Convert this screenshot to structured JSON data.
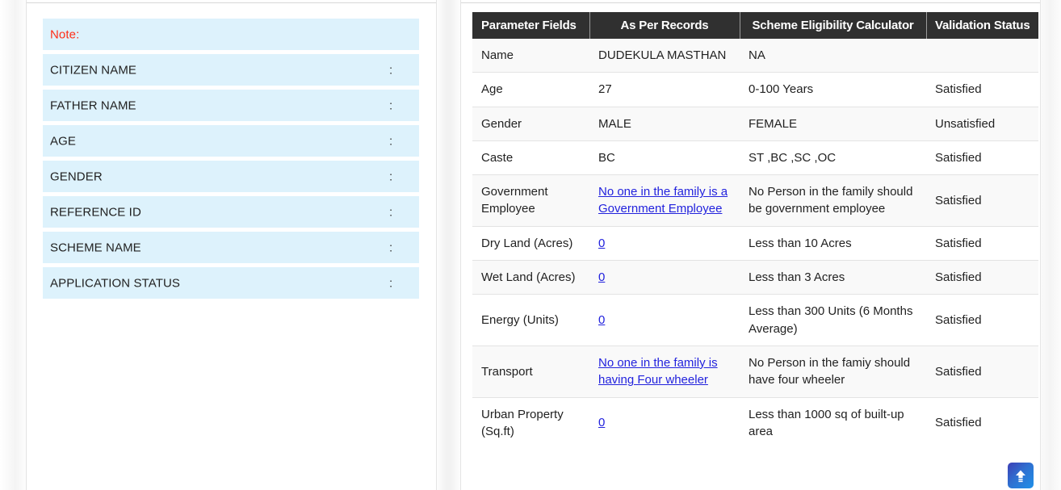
{
  "left_panel": {
    "rows": [
      {
        "label": "Note:",
        "colon": "",
        "is_note": true
      },
      {
        "label": "CITIZEN NAME",
        "colon": ":",
        "is_note": false
      },
      {
        "label": "FATHER NAME",
        "colon": ":",
        "is_note": false
      },
      {
        "label": "AGE",
        "colon": ":",
        "is_note": false
      },
      {
        "label": "GENDER",
        "colon": ":",
        "is_note": false
      },
      {
        "label": "REFERENCE ID",
        "colon": ":",
        "is_note": false
      },
      {
        "label": "SCHEME NAME",
        "colon": ":",
        "is_note": false
      },
      {
        "label": "APPLICATION STATUS",
        "colon": ":",
        "is_note": false
      }
    ]
  },
  "table": {
    "headers": [
      "Parameter Fields",
      "As Per Records",
      "Scheme Eligibility Calculator",
      "Validation Status"
    ],
    "rows": [
      {
        "parameter": "Name",
        "as_per_records": "DUDEKULA MASTHAN",
        "record_is_link": false,
        "calculator": "NA",
        "status": ""
      },
      {
        "parameter": "Age",
        "as_per_records": "27",
        "record_is_link": false,
        "calculator": "0-100 Years",
        "status": "Satisfied"
      },
      {
        "parameter": "Gender",
        "as_per_records": "MALE",
        "record_is_link": false,
        "calculator": "FEMALE",
        "status": "Unsatisfied"
      },
      {
        "parameter": "Caste",
        "as_per_records": "BC",
        "record_is_link": false,
        "calculator": "ST ,BC ,SC ,OC",
        "status": "Satisfied"
      },
      {
        "parameter": "Government Employee",
        "as_per_records": "No one in the  family is a Government  Employee",
        "record_is_link": true,
        "calculator": "No Person in the family should be government employee",
        "status": "Satisfied"
      },
      {
        "parameter": "Dry Land (Acres)",
        "as_per_records": "0",
        "record_is_link": true,
        "calculator": "Less than 10 Acres",
        "status": "Satisfied"
      },
      {
        "parameter": "Wet Land (Acres)",
        "as_per_records": "0",
        "record_is_link": true,
        "calculator": "Less than 3 Acres",
        "status": "Satisfied"
      },
      {
        "parameter": "Energy (Units)",
        "as_per_records": "0",
        "record_is_link": true,
        "calculator": "Less than 300 Units (6 Months Average)",
        "status": "Satisfied"
      },
      {
        "parameter": "Transport",
        "as_per_records": "No one in the family is having Four wheeler",
        "record_is_link": true,
        "calculator": "No Person in the famiy should have four wheeler",
        "status": "Satisfied"
      },
      {
        "parameter": "Urban Property (Sq.ft)",
        "as_per_records": "0",
        "record_is_link": true,
        "calculator": "Less than 1000 sq of built-up area",
        "status": "Satisfied"
      }
    ]
  },
  "controls": {
    "scroll_top_icon": "arrow-up-icon",
    "scroll_top_title": "Scroll to top"
  },
  "colors": {
    "note_row_bg": "#ddf2fc",
    "note_text": "#ff2d17",
    "header_bg": "#303030",
    "header_text": "#ffffff",
    "link": "#2222dd",
    "row_alt_bg": "#f9f9f9",
    "scroll_btn_gradient_start": "#3d3fb5",
    "scroll_btn_gradient_end": "#1e90e8"
  }
}
